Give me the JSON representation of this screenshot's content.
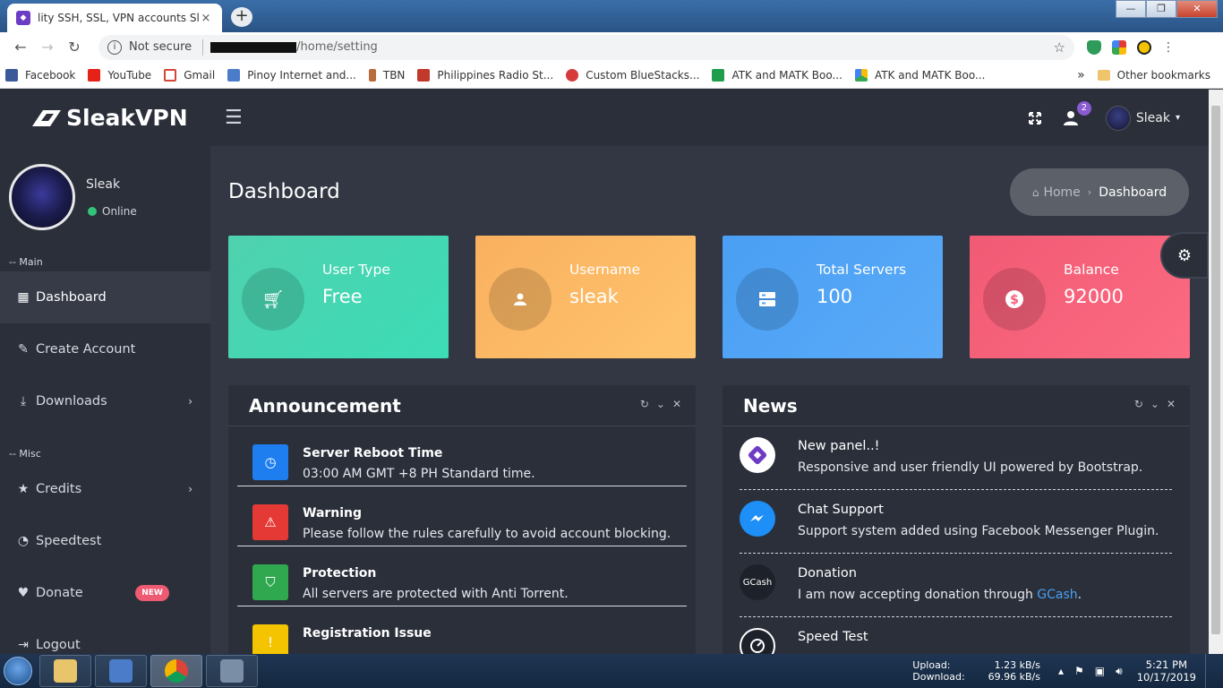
{
  "browser": {
    "tab_title": "lity SSH, SSL, VPN accounts Sleak",
    "tab_close": "×",
    "new_tab": "+",
    "not_secure": "Not secure",
    "url": "/home/setting",
    "window_buttons": [
      "—",
      "❐",
      "✕"
    ],
    "bookmarks": [
      {
        "label": "Facebook",
        "color": "#3b5998"
      },
      {
        "label": "YouTube",
        "color": "#e62117"
      },
      {
        "label": "Gmail",
        "color": "#d44638"
      },
      {
        "label": "Pinoy Internet and...",
        "color": "#4a7cc9"
      },
      {
        "label": "TBN",
        "color": "#b86b3c"
      },
      {
        "label": "Philippines Radio St...",
        "color": "#c0392b"
      },
      {
        "label": "Custom BlueStacks...",
        "color": "#d63a3a"
      },
      {
        "label": "ATK and MATK Boo...",
        "color": "#1e9e4a"
      },
      {
        "label": "ATK and MATK Boo...",
        "color": "#f4b400"
      }
    ],
    "bookmarks_more": "»",
    "other_bookmarks": "Other bookmarks"
  },
  "app": {
    "brand": "SleakVPN",
    "notifications_count": "2",
    "user_name": "Sleak",
    "profile": {
      "name": "Sleak",
      "status": "Online"
    },
    "sections": {
      "main": "-- Main",
      "misc": "-- Misc"
    },
    "menu": [
      {
        "label": "Dashboard",
        "icon": "dashboard-icon",
        "active": true
      },
      {
        "label": "Create Account",
        "icon": "pencil-icon"
      },
      {
        "label": "Downloads",
        "icon": "download-icon",
        "has_chevron": true
      }
    ],
    "misc_menu": [
      {
        "label": "Credits",
        "icon": "star-icon",
        "has_chevron": true
      },
      {
        "label": "Speedtest",
        "icon": "speedometer-icon"
      },
      {
        "label": "Donate",
        "icon": "heart-icon",
        "badge": "NEW"
      },
      {
        "label": "Logout",
        "icon": "logout-icon"
      }
    ],
    "page_title": "Dashboard",
    "breadcrumb": {
      "home": "Home",
      "current": "Dashboard"
    },
    "stats": [
      {
        "label": "User Type",
        "value": "Free",
        "icon": "cart-icon",
        "color": "#43d5b0"
      },
      {
        "label": "Username",
        "value": "sleak",
        "icon": "user-icon",
        "color": "#fcb865"
      },
      {
        "label": "Total Servers",
        "value": "100",
        "icon": "server-icon",
        "color": "#4fa4f5"
      },
      {
        "label": "Balance",
        "value": "92000",
        "icon": "dollar-icon",
        "color": "#f6607a"
      }
    ],
    "announcement": {
      "title": "Announcement",
      "items": [
        {
          "title": "Server Reboot Time",
          "desc": "03:00 AM GMT +8 PH Standard time.",
          "icon": "clock-icon",
          "color": "#1e7ef0"
        },
        {
          "title": "Warning",
          "desc": "Please follow the rules carefully to avoid account blocking.",
          "icon": "warning-icon",
          "color": "#e53935"
        },
        {
          "title": "Protection",
          "desc": "All servers are protected with Anti Torrent.",
          "icon": "shield-icon",
          "color": "#2fa84f"
        },
        {
          "title": "Registration Issue",
          "desc": "",
          "icon": "alert-icon",
          "color": "#f5c400"
        }
      ]
    },
    "news": {
      "title": "News",
      "items": [
        {
          "title": "New panel..!",
          "desc": "Responsive and user friendly UI powered by Bootstrap.",
          "icon": "bootstrap-icon"
        },
        {
          "title": "Chat Support",
          "desc": "Support system added using Facebook Messenger Plugin.",
          "icon": "messenger-icon"
        },
        {
          "title": "Donation",
          "desc_prefix": "I am now accepting donation through ",
          "desc_link": "GCash",
          "desc_suffix": ".",
          "icon": "gcash-icon",
          "icon_text": "GCash"
        },
        {
          "title": "Speed Test",
          "desc": "",
          "icon": "speedometer-icon"
        }
      ]
    }
  },
  "taskbar": {
    "upload_label": "Upload:",
    "upload_value": "1.23 kB/s",
    "download_label": "Download:",
    "download_value": "69.96 kB/s",
    "time": "5:21 PM",
    "date": "10/17/2019"
  }
}
